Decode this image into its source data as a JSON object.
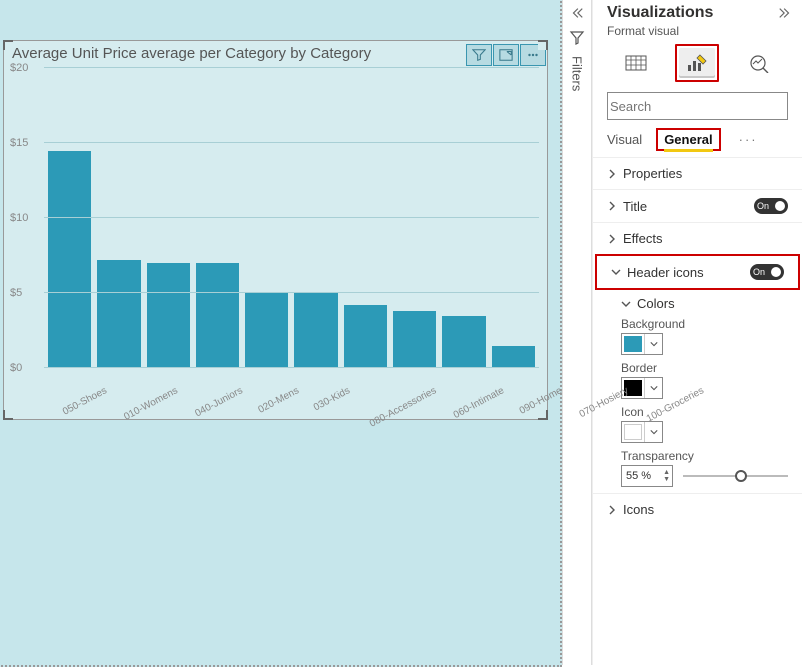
{
  "filters_rail": {
    "label": "Filters"
  },
  "panel": {
    "title": "Visualizations",
    "subtitle": "Format visual",
    "search_placeholder": "Search",
    "tabs": {
      "visual": "Visual",
      "general": "General"
    },
    "sections": {
      "properties": "Properties",
      "title": "Title",
      "title_toggle": "On",
      "effects": "Effects",
      "header_icons": "Header icons",
      "header_icons_toggle": "On",
      "colors": "Colors",
      "background": "Background",
      "border": "Border",
      "icon": "Icon",
      "transparency": "Transparency",
      "transparency_value": "55 %",
      "icons": "Icons"
    },
    "colors": {
      "background": "#2c9ab7",
      "border": "#000000",
      "icon": "#ffffff"
    },
    "transparency_pct": 55
  },
  "chart_data": {
    "type": "bar",
    "title": "Average Unit Price average per Category by Category",
    "xlabel": "",
    "ylabel": "",
    "ylim": [
      0,
      20
    ],
    "yticks": [
      0,
      5,
      10,
      15,
      20
    ],
    "ytick_labels": [
      "$0",
      "$5",
      "$10",
      "$15",
      "$20"
    ],
    "categories": [
      "050-Shoes",
      "010-Womens",
      "040-Juniors",
      "020-Mens",
      "030-Kids",
      "080-Accessories",
      "060-Intimate",
      "090-Home",
      "070-Hosiery",
      "100-Groceries"
    ],
    "values": [
      14.5,
      7.2,
      7.0,
      7.0,
      5.1,
      5.0,
      4.2,
      3.8,
      3.5,
      1.5
    ]
  }
}
